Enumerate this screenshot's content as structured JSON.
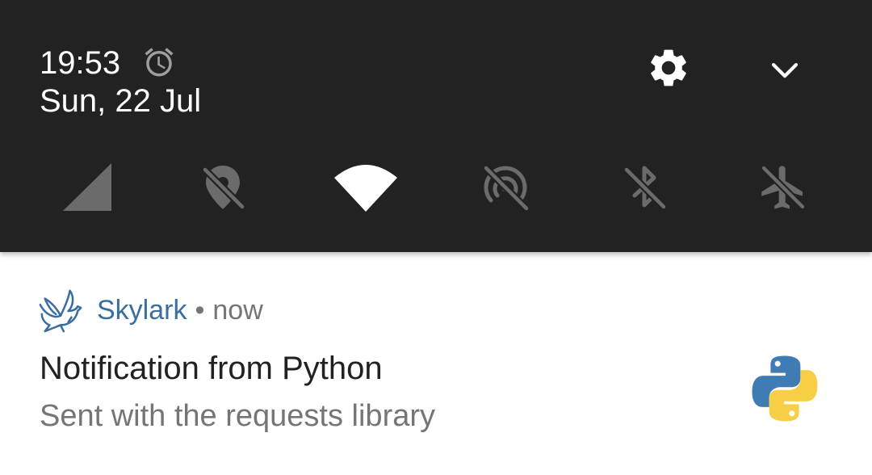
{
  "status": {
    "time": "19:53",
    "date": "Sun, 22 Jul",
    "icons": {
      "alarm": "alarm-clock-icon",
      "settings": "gear-icon",
      "expand": "chevron-down-icon"
    }
  },
  "quick_tiles": [
    {
      "name": "mobile-signal",
      "icon": "signal-triangle-icon",
      "active": true
    },
    {
      "name": "location",
      "icon": "location-off-icon",
      "active": false
    },
    {
      "name": "wifi",
      "icon": "wifi-icon",
      "active": true
    },
    {
      "name": "hotspot",
      "icon": "hotspot-off-icon",
      "active": false
    },
    {
      "name": "bluetooth",
      "icon": "bluetooth-off-icon",
      "active": false
    },
    {
      "name": "airplane-mode",
      "icon": "airplane-off-icon",
      "active": false
    }
  ],
  "notification": {
    "app_name": "Skylark",
    "separator": "•",
    "time": "now",
    "title": "Notification from Python",
    "text": "Sent with the requests library",
    "app_icon": "skylark-bird-icon",
    "large_icon": "python-logo-icon"
  },
  "colors": {
    "shade_bg": "#222222",
    "active_icon": "#ffffff",
    "inactive_icon": "#6b6b6b",
    "app_accent": "#3a6ea0",
    "python_blue": "#3f7cb4",
    "python_yellow": "#f7cf47"
  }
}
